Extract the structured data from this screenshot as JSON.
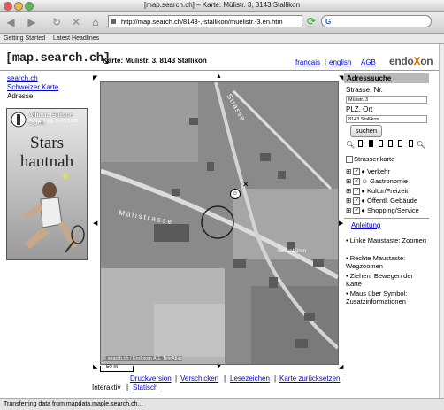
{
  "window": {
    "title": "[map.search.ch] – Karte: Mülistr. 3, 8143 Stallikon"
  },
  "toolbar": {
    "url": "http://map.search.ch/8143-,-stallikon/muelistr.-3.en.htm",
    "search_value": ""
  },
  "bookmarks": [
    "Getting Started",
    "Latest Headlines"
  ],
  "header": {
    "logo": "[map.search.ch]",
    "page_title": "Karte: Mülistr. 3, 8143 Stallikon",
    "lang_fr": "français",
    "lang_en": "english",
    "agb": "AGB",
    "brand_main": "endo",
    "brand_accent": "X",
    "brand_end": "on"
  },
  "left_nav": {
    "link1": "search.ch",
    "link2": "Schweizer Karte",
    "current": "Adresse"
  },
  "ad": {
    "title": "Allianz Suisse Open",
    "subtitle": "Gstaad • July 2–10, 2005",
    "text": "Stars hautnah"
  },
  "map": {
    "street1": "Mülistrasse",
    "street2": "Strasse",
    "place": "Sellenbüren",
    "copyright": "© search.ch / Endoxon AG, TeleAtlas",
    "scale": "50 m"
  },
  "panel": {
    "heading": "Adresssuche",
    "street_label": "Strasse, Nr.",
    "street_value": "Mülistr. 3",
    "city_label": "PLZ, Ort",
    "city_value": "8143 Stallikon",
    "search_button": "suchen",
    "street_map_label": "Strassenkarte",
    "categories": [
      "Verkehr",
      "Gastronomie",
      "Kultur/Freizeit",
      "Öffentl. Gebäude",
      "Shopping/Service"
    ],
    "help_link": "Anleitung",
    "help": [
      "Linke Maustaste: Zoomen",
      "Rechte Maustaste: Wegzoomen",
      "Ziehen: Bewegen der Karte",
      "Maus über Symbol: Zusatzinformationen"
    ]
  },
  "bottom": {
    "print": "Druckversion",
    "send": "Verschicken",
    "bookmark": "Lesezeichen",
    "reset": "Karte zurücksetzen",
    "interactive": "Interaktiv",
    "static": "Statisch"
  },
  "status": {
    "text": "Transferring data from mapdata.maple.search.ch..."
  },
  "colors": {
    "link": "#0000cc",
    "brand_accent": "#e07000"
  }
}
